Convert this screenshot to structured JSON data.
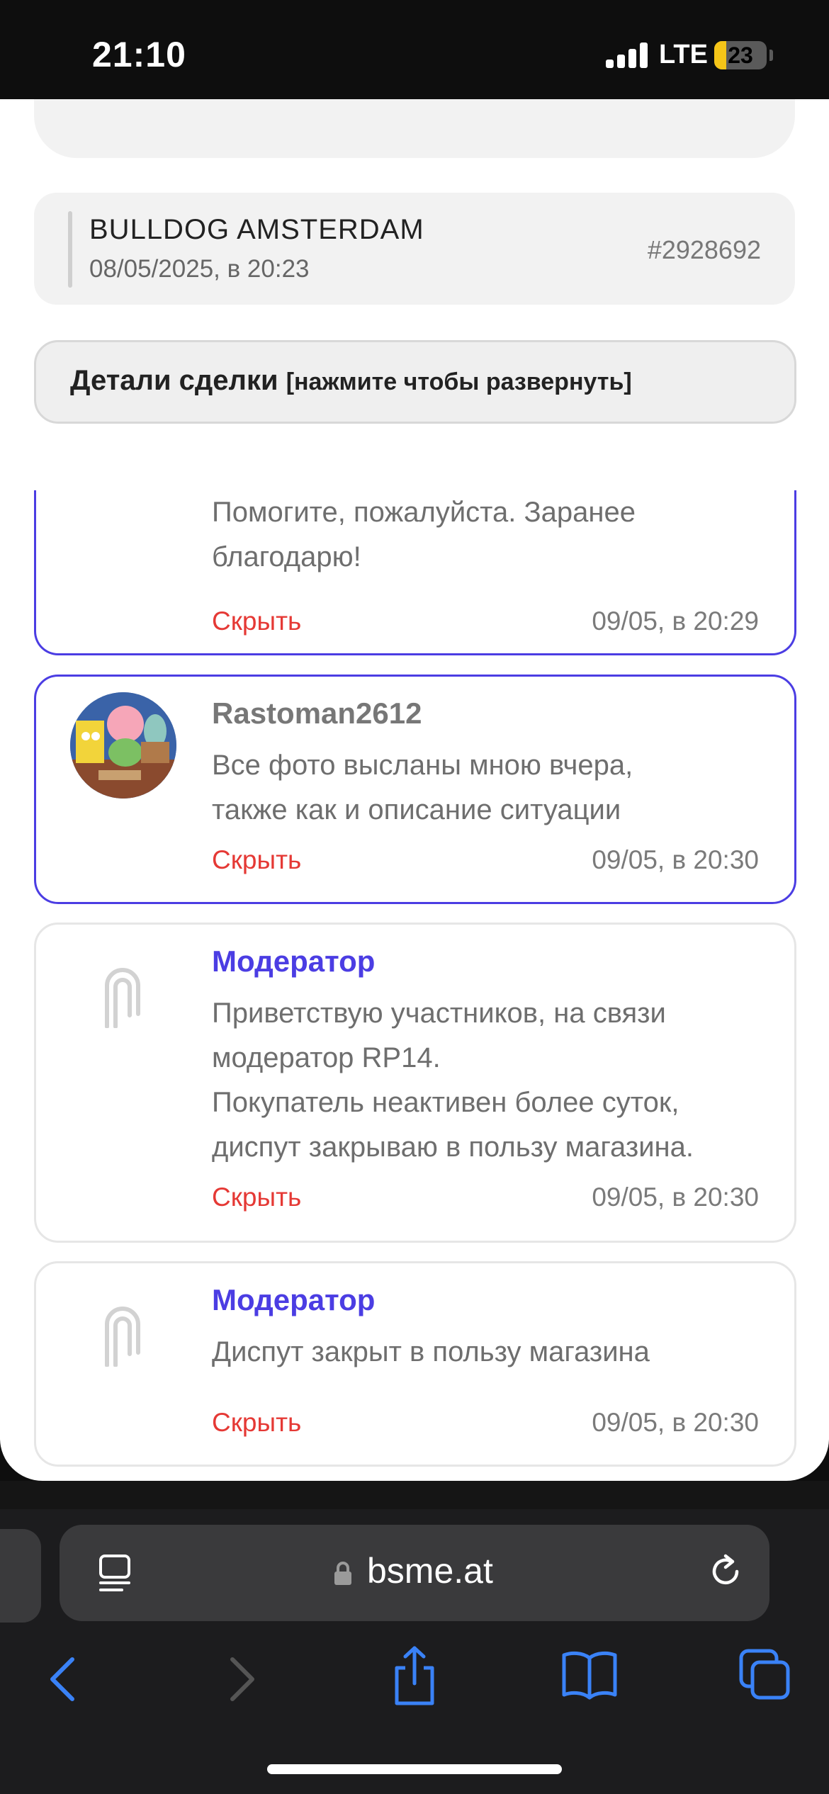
{
  "status_bar": {
    "time": "21:10",
    "network": "LTE",
    "battery": "23",
    "battery_level": 0.23
  },
  "shop": {
    "name": "BULLDOG AMSTERDAM",
    "date": "08/05/2025, в 20:23",
    "order_id": "#2928692"
  },
  "details": {
    "title": "Детали сделки",
    "hint": "[нажмите чтобы развернуть]"
  },
  "messages": [
    {
      "author": "",
      "text": "Помогите, пожалуйста. Заранее\nблагодарю!",
      "hide": "Скрыть",
      "time": "09/05, в 20:29"
    },
    {
      "author": "Rastoman2612",
      "text": "Все фото высланы мною вчера,\nтакже как и описание ситуации",
      "hide": "Скрыть",
      "time": "09/05, в 20:30"
    },
    {
      "author": "Модератор",
      "text": "Приветствую участников, на связи\nмодератор RP14.\nПокупатель неактивен более суток,\nдиспут закрываю в пользу магазина.",
      "hide": "Скрыть",
      "time": "09/05, в 20:30"
    },
    {
      "author": "Модератор",
      "text": "Диспут закрыт в пользу магазина",
      "hide": "Скрыть",
      "time": "09/05, в 20:30"
    }
  ],
  "browser": {
    "url": "bsme.at",
    "icons": [
      "reader-icon",
      "lock-icon",
      "reload-icon",
      "back-icon",
      "forward-icon",
      "share-icon",
      "bookmarks-icon",
      "tabs-icon"
    ]
  },
  "colors": {
    "accent": "#4b3de3",
    "hide_red": "#e53935",
    "ios_blue": "#3a82f7"
  }
}
